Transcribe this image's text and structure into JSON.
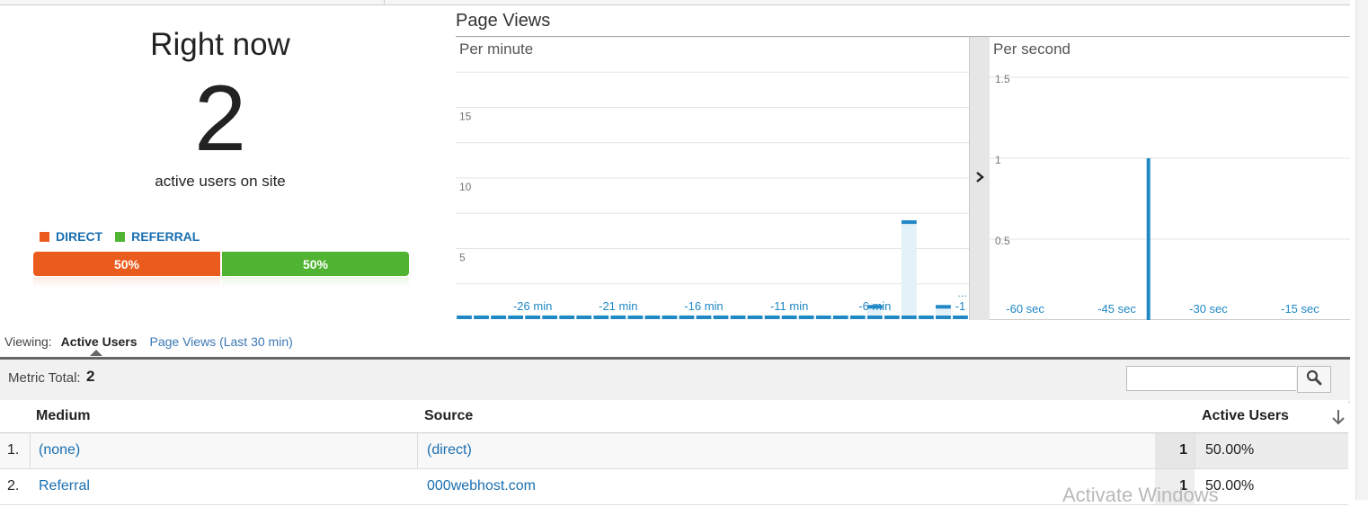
{
  "realtime": {
    "title": "Right now",
    "active_count": "2",
    "subtitle": "active users on site"
  },
  "legend": [
    {
      "label": "DIRECT",
      "color": "#ea5b1e"
    },
    {
      "label": "REFERRAL",
      "color": "#50b432"
    }
  ],
  "split_bar": [
    {
      "label": "50%",
      "share": 0.5,
      "color": "#ea5b1e"
    },
    {
      "label": "50%",
      "share": 0.5,
      "color": "#50b432"
    }
  ],
  "page_views": {
    "title": "Page Views",
    "expand_icon": "chevron-right-icon"
  },
  "chart_data": [
    {
      "type": "bar",
      "title": "Per minute",
      "ylim": [
        0,
        20
      ],
      "y_ticks": [
        "15",
        "10",
        "5"
      ],
      "y_tick_values": [
        15,
        10,
        5
      ],
      "x_tick_labels": [
        "-26 min",
        "-21 min",
        "-16 min",
        "-11 min",
        "-6 min",
        "-1"
      ],
      "x_tick_values": [
        -26,
        -21,
        -16,
        -11,
        -6,
        -1
      ],
      "x": [
        -30,
        -29,
        -28,
        -27,
        -26,
        -25,
        -24,
        -23,
        -22,
        -21,
        -20,
        -19,
        -18,
        -17,
        -16,
        -15,
        -14,
        -13,
        -12,
        -11,
        -10,
        -9,
        -8,
        -7,
        -6,
        -5,
        -4,
        -3,
        -2,
        -1
      ],
      "values": [
        0,
        0,
        0,
        0,
        0,
        0,
        0,
        0,
        0,
        0,
        0,
        0,
        0,
        0,
        0,
        0,
        0,
        0,
        0,
        0,
        0,
        0,
        0,
        0,
        1,
        0,
        7,
        0,
        1,
        0
      ],
      "grid": true,
      "color": "#1f88c5"
    },
    {
      "type": "bar",
      "title": "Per second",
      "ylim": [
        0,
        1.75
      ],
      "y_ticks": [
        "1.5",
        "1",
        "0.5"
      ],
      "y_tick_values": [
        1.5,
        1,
        0.5
      ],
      "x_tick_labels": [
        "-60 sec",
        "-45 sec",
        "-30 sec",
        "-15 sec"
      ],
      "x_tick_values": [
        -60,
        -45,
        -30,
        -15
      ],
      "x": [
        -36
      ],
      "values": [
        1
      ],
      "grid": true,
      "color": "#1f88c5"
    }
  ],
  "viewing": {
    "label": "Viewing:",
    "active_tab": "Active Users",
    "other_tab": "Page Views (Last 30 min)"
  },
  "metric": {
    "label": "Metric Total:",
    "value": "2"
  },
  "search": {
    "value": "",
    "icon": "search-icon"
  },
  "table": {
    "columns": [
      "Medium",
      "Source",
      "Active Users"
    ],
    "sort_icon": "arrow-down-icon",
    "rows": [
      {
        "index": "1.",
        "medium": "(none)",
        "source": "(direct)",
        "users": "1",
        "percent": "50.00%"
      },
      {
        "index": "2.",
        "medium": "Referral",
        "source": "000webhost.com",
        "users": "1",
        "percent": "50.00%"
      }
    ]
  },
  "watermark": "Activate Windows"
}
